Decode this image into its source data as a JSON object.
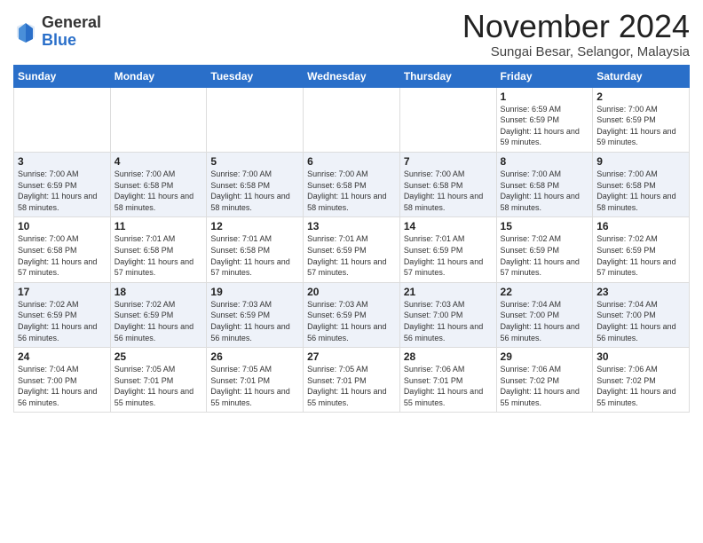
{
  "header": {
    "logo_general": "General",
    "logo_blue": "Blue",
    "month_title": "November 2024",
    "location": "Sungai Besar, Selangor, Malaysia"
  },
  "weekdays": [
    "Sunday",
    "Monday",
    "Tuesday",
    "Wednesday",
    "Thursday",
    "Friday",
    "Saturday"
  ],
  "weeks": [
    [
      {
        "day": "",
        "detail": ""
      },
      {
        "day": "",
        "detail": ""
      },
      {
        "day": "",
        "detail": ""
      },
      {
        "day": "",
        "detail": ""
      },
      {
        "day": "",
        "detail": ""
      },
      {
        "day": "1",
        "detail": "Sunrise: 6:59 AM\nSunset: 6:59 PM\nDaylight: 11 hours and 59 minutes."
      },
      {
        "day": "2",
        "detail": "Sunrise: 7:00 AM\nSunset: 6:59 PM\nDaylight: 11 hours and 59 minutes."
      }
    ],
    [
      {
        "day": "3",
        "detail": "Sunrise: 7:00 AM\nSunset: 6:59 PM\nDaylight: 11 hours and 58 minutes."
      },
      {
        "day": "4",
        "detail": "Sunrise: 7:00 AM\nSunset: 6:58 PM\nDaylight: 11 hours and 58 minutes."
      },
      {
        "day": "5",
        "detail": "Sunrise: 7:00 AM\nSunset: 6:58 PM\nDaylight: 11 hours and 58 minutes."
      },
      {
        "day": "6",
        "detail": "Sunrise: 7:00 AM\nSunset: 6:58 PM\nDaylight: 11 hours and 58 minutes."
      },
      {
        "day": "7",
        "detail": "Sunrise: 7:00 AM\nSunset: 6:58 PM\nDaylight: 11 hours and 58 minutes."
      },
      {
        "day": "8",
        "detail": "Sunrise: 7:00 AM\nSunset: 6:58 PM\nDaylight: 11 hours and 58 minutes."
      },
      {
        "day": "9",
        "detail": "Sunrise: 7:00 AM\nSunset: 6:58 PM\nDaylight: 11 hours and 58 minutes."
      }
    ],
    [
      {
        "day": "10",
        "detail": "Sunrise: 7:00 AM\nSunset: 6:58 PM\nDaylight: 11 hours and 57 minutes."
      },
      {
        "day": "11",
        "detail": "Sunrise: 7:01 AM\nSunset: 6:58 PM\nDaylight: 11 hours and 57 minutes."
      },
      {
        "day": "12",
        "detail": "Sunrise: 7:01 AM\nSunset: 6:58 PM\nDaylight: 11 hours and 57 minutes."
      },
      {
        "day": "13",
        "detail": "Sunrise: 7:01 AM\nSunset: 6:59 PM\nDaylight: 11 hours and 57 minutes."
      },
      {
        "day": "14",
        "detail": "Sunrise: 7:01 AM\nSunset: 6:59 PM\nDaylight: 11 hours and 57 minutes."
      },
      {
        "day": "15",
        "detail": "Sunrise: 7:02 AM\nSunset: 6:59 PM\nDaylight: 11 hours and 57 minutes."
      },
      {
        "day": "16",
        "detail": "Sunrise: 7:02 AM\nSunset: 6:59 PM\nDaylight: 11 hours and 57 minutes."
      }
    ],
    [
      {
        "day": "17",
        "detail": "Sunrise: 7:02 AM\nSunset: 6:59 PM\nDaylight: 11 hours and 56 minutes."
      },
      {
        "day": "18",
        "detail": "Sunrise: 7:02 AM\nSunset: 6:59 PM\nDaylight: 11 hours and 56 minutes."
      },
      {
        "day": "19",
        "detail": "Sunrise: 7:03 AM\nSunset: 6:59 PM\nDaylight: 11 hours and 56 minutes."
      },
      {
        "day": "20",
        "detail": "Sunrise: 7:03 AM\nSunset: 6:59 PM\nDaylight: 11 hours and 56 minutes."
      },
      {
        "day": "21",
        "detail": "Sunrise: 7:03 AM\nSunset: 7:00 PM\nDaylight: 11 hours and 56 minutes."
      },
      {
        "day": "22",
        "detail": "Sunrise: 7:04 AM\nSunset: 7:00 PM\nDaylight: 11 hours and 56 minutes."
      },
      {
        "day": "23",
        "detail": "Sunrise: 7:04 AM\nSunset: 7:00 PM\nDaylight: 11 hours and 56 minutes."
      }
    ],
    [
      {
        "day": "24",
        "detail": "Sunrise: 7:04 AM\nSunset: 7:00 PM\nDaylight: 11 hours and 56 minutes."
      },
      {
        "day": "25",
        "detail": "Sunrise: 7:05 AM\nSunset: 7:01 PM\nDaylight: 11 hours and 55 minutes."
      },
      {
        "day": "26",
        "detail": "Sunrise: 7:05 AM\nSunset: 7:01 PM\nDaylight: 11 hours and 55 minutes."
      },
      {
        "day": "27",
        "detail": "Sunrise: 7:05 AM\nSunset: 7:01 PM\nDaylight: 11 hours and 55 minutes."
      },
      {
        "day": "28",
        "detail": "Sunrise: 7:06 AM\nSunset: 7:01 PM\nDaylight: 11 hours and 55 minutes."
      },
      {
        "day": "29",
        "detail": "Sunrise: 7:06 AM\nSunset: 7:02 PM\nDaylight: 11 hours and 55 minutes."
      },
      {
        "day": "30",
        "detail": "Sunrise: 7:06 AM\nSunset: 7:02 PM\nDaylight: 11 hours and 55 minutes."
      }
    ]
  ]
}
